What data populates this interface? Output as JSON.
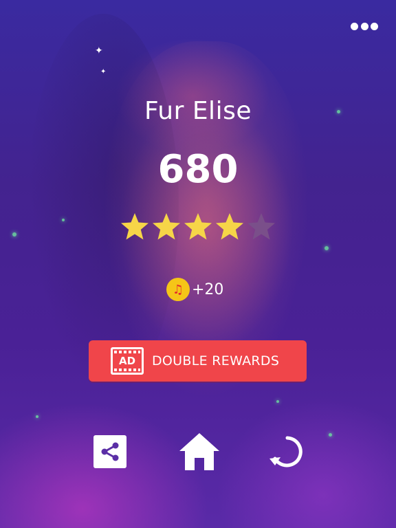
{
  "song": {
    "title": "Fur Elise"
  },
  "result": {
    "score": "680",
    "stars_earned": 4,
    "stars_total": 5
  },
  "reward": {
    "icon": "music-note-coin-icon",
    "amount": "+20"
  },
  "ad_button": {
    "badge": "AD",
    "label": "DOUBLE REWARDS"
  },
  "actions": {
    "menu_icon": "more-dots-icon",
    "share_icon": "share-icon",
    "home_icon": "home-icon",
    "replay_icon": "replay-icon"
  },
  "colors": {
    "star_filled": "#f6d548",
    "star_empty": "#7a4f8a",
    "button_red": "#f0454a",
    "coin_yellow": "#f5c518"
  }
}
